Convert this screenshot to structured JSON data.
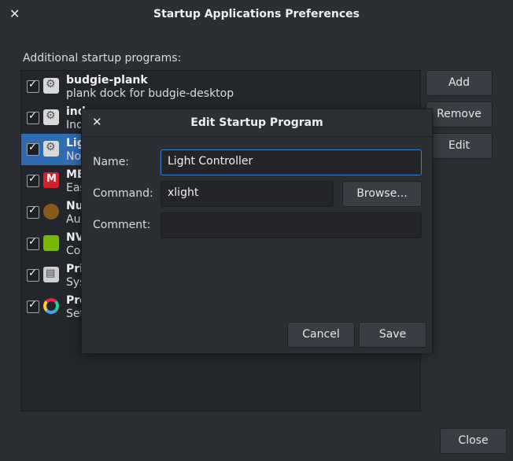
{
  "window": {
    "title": "Startup Applications Preferences"
  },
  "list_label": "Additional startup programs:",
  "programs": [
    {
      "name": "budgie-plank",
      "comment": "plank dock for budgie-desktop",
      "icon": "gear-icon",
      "checked": true
    },
    {
      "name": "ind",
      "comment": "Ind",
      "icon": "gear-icon",
      "checked": true
    },
    {
      "name": "Lig",
      "comment": "No",
      "icon": "gear-icon",
      "checked": true
    },
    {
      "name": "ME",
      "comment": "Eas",
      "icon": "mega-icon",
      "checked": true
    },
    {
      "name": "Nu",
      "comment": "Au",
      "icon": "acorn-icon",
      "checked": true
    },
    {
      "name": "NV",
      "comment": "Co",
      "icon": "nvidia-icon",
      "checked": true
    },
    {
      "name": "Pri",
      "comment": "Sys",
      "icon": "printer-icon",
      "checked": true
    },
    {
      "name": "Pre",
      "comment": "Set",
      "icon": "color-ring-icon",
      "checked": true
    }
  ],
  "buttons": {
    "add": "Add",
    "remove": "Remove",
    "edit": "Edit",
    "close": "Close"
  },
  "dialog": {
    "title": "Edit Startup Program",
    "name_label": "Name:",
    "name_value": "Light Controller",
    "command_label": "Command:",
    "command_value": "xlight",
    "browse": "Browse...",
    "comment_label": "Comment:",
    "comment_value": "",
    "cancel": "Cancel",
    "save": "Save"
  },
  "colors": {
    "selection": "#2f6bb0",
    "focus": "#3d7fd3",
    "background": "#2b2e33"
  }
}
